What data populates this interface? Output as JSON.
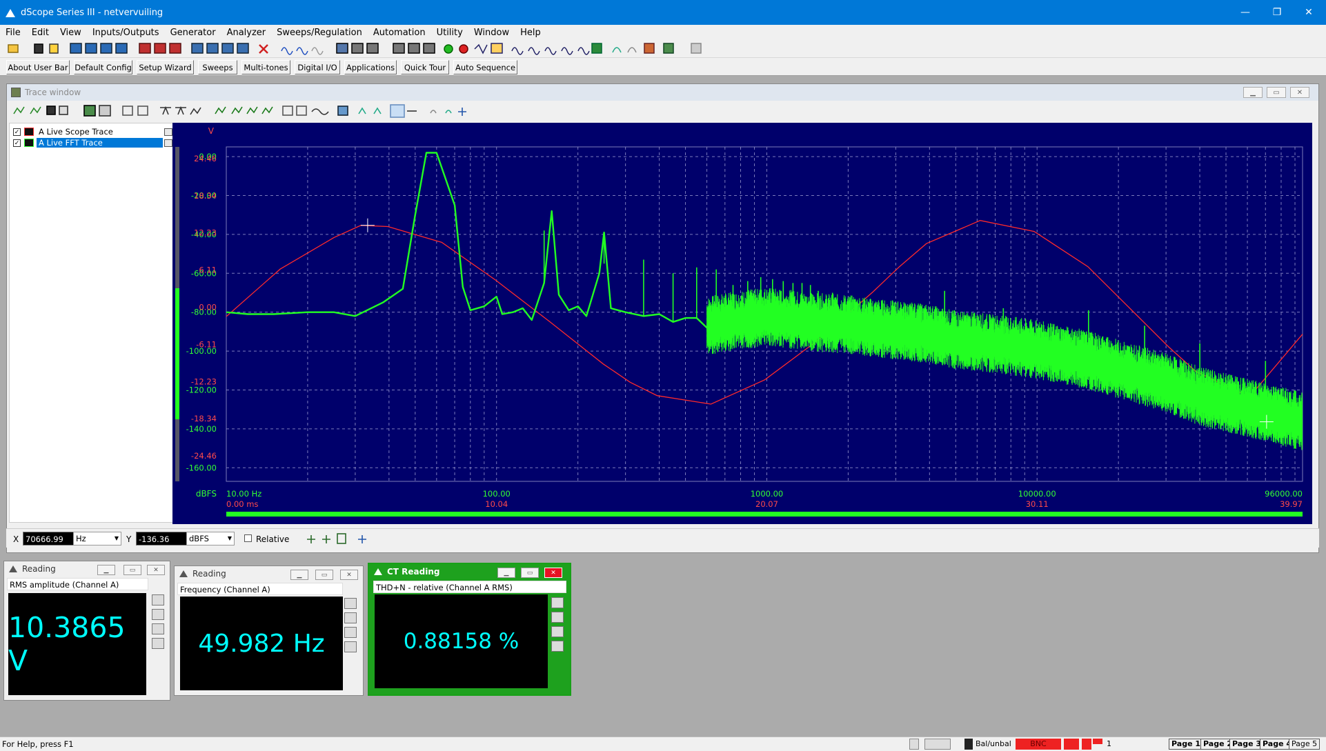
{
  "app": {
    "title": "dScope Series III - netvervuiling",
    "window_controls": [
      "—",
      "❐",
      "✕"
    ]
  },
  "menu": [
    "File",
    "Edit",
    "View",
    "Inputs/Outputs",
    "Generator",
    "Analyzer",
    "Sweeps/Regulation",
    "Automation",
    "Utility",
    "Window",
    "Help"
  ],
  "user_bar": [
    "About User Bar",
    "Default Config",
    "Setup Wizard",
    "Sweeps",
    "Multi-tones",
    "Digital I/O",
    "Applications",
    "Quick Tour",
    "Auto Sequence"
  ],
  "trace_window": {
    "title": "Trace window",
    "traces": [
      {
        "label": "A  Live Scope Trace",
        "checked": true,
        "selected": false,
        "icon_color": "#ff3030"
      },
      {
        "label": "A  Live FFT Trace",
        "checked": true,
        "selected": true,
        "icon_color": "#30ff30"
      }
    ]
  },
  "chart_data": {
    "type": "line",
    "x_scale": "log",
    "xlim": [
      10,
      96000
    ],
    "x_ticks": [
      "10.00 Hz",
      "100.00",
      "1000.00",
      "10000.00",
      "96000.00"
    ],
    "x2_ticks": [
      "0.00 ms",
      "10.04",
      "20.07",
      "30.11",
      "39.97"
    ],
    "y_left_unit": "dBFS",
    "y_left_ticks": [
      "0.00",
      "-20.00",
      "-40.00",
      "-60.00",
      "-80.00",
      "-100.00",
      "-120.00",
      "-140.00",
      "-160.00"
    ],
    "ylim_left": [
      -167,
      5
    ],
    "y_right_unit": "V",
    "y_right_ticks": [
      "24.46",
      "18.34",
      "12.23",
      "6.11",
      "0.00",
      "-6.11",
      "-12.23",
      "-18.34",
      "-24.46"
    ],
    "ylim_right": [
      -27.5,
      27.5
    ],
    "grid": true,
    "series": [
      {
        "color": "#ff2a2a",
        "axis": "right",
        "x_axis": "time_ms",
        "x": [
          0,
          2,
          4,
          5,
          6,
          8,
          10,
          12,
          14,
          15,
          16,
          18,
          20,
          22,
          24,
          25,
          26,
          28,
          30,
          32,
          34,
          35,
          36,
          38,
          39.97
        ],
        "values": [
          -0.4,
          7.4,
          12.6,
          14.6,
          14.4,
          11.8,
          5.6,
          -1.2,
          -8.2,
          -11.2,
          -13.4,
          -14.8,
          -10.8,
          -4.2,
          3.6,
          7.8,
          11.6,
          15.4,
          13.6,
          7.8,
          -1.0,
          -5.4,
          -9.4,
          -13.6,
          -3.3
        ]
      },
      {
        "color": "#22ff22",
        "axis": "left",
        "x_axis": "frequency_hz",
        "x": [
          10,
          12,
          15,
          20,
          25,
          30,
          38,
          45,
          50,
          55,
          60,
          70,
          75,
          80,
          90,
          100,
          105,
          115,
          125,
          135,
          150,
          160,
          170,
          185,
          200,
          215,
          240,
          250,
          265,
          300,
          350,
          400,
          450,
          500,
          550,
          600,
          700,
          800,
          1000,
          1500,
          2000,
          2500,
          3000,
          4000,
          5000,
          6000,
          8000,
          10000,
          15000,
          20000,
          30000,
          40000,
          60000,
          96000
        ],
        "values": [
          -80,
          -81,
          -81,
          -80,
          -80,
          -82,
          -75,
          -68,
          -30,
          2,
          2,
          -25,
          -67,
          -79,
          -77,
          -72,
          -81,
          -80,
          -78,
          -84,
          -65,
          -28,
          -71,
          -79,
          -77,
          -82,
          -60,
          -39,
          -78,
          -80,
          -82,
          -81,
          -85,
          -83,
          -83,
          -88,
          -86,
          -85,
          -83,
          -86,
          -87,
          -89,
          -90,
          -92,
          -95,
          -96,
          -98,
          -100,
          -105,
          -110,
          -117,
          -124,
          -130,
          -137
        ]
      }
    ]
  },
  "cursor": {
    "x_label": "X",
    "x_value": "70666.99",
    "x_unit": "Hz",
    "y_label": "Y",
    "y_value": "-136.36",
    "y_unit": "dBFS",
    "relative_label": "Relative"
  },
  "readings": [
    {
      "title": "Reading",
      "sub": "RMS amplitude (Channel A)",
      "value": "10.3865 V",
      "active": false
    },
    {
      "title": "Reading",
      "sub": "Frequency (Channel A)",
      "value": "49.982 Hz",
      "active": false
    },
    {
      "title": "CT Reading",
      "sub": "THD+N - relative (Channel A RMS)",
      "value": "0.88158 %",
      "active": true
    }
  ],
  "status": {
    "help": "For Help, press F1",
    "balunbal": "Bal/unbal",
    "bnc": "BNC",
    "ch_count": "1",
    "pages": [
      "Page 1",
      "Page 2",
      "Page 3",
      "Page 4",
      "Page 5"
    ]
  }
}
